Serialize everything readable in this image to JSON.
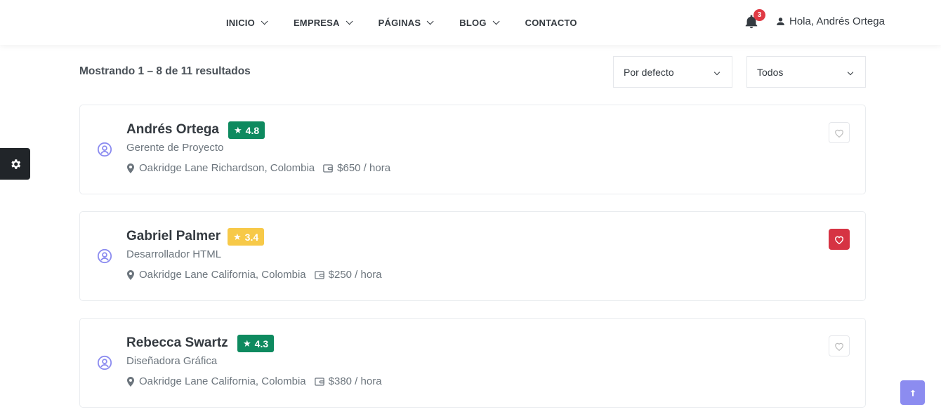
{
  "nav": {
    "items": [
      {
        "label": "INICIO",
        "has_dropdown": true
      },
      {
        "label": "EMPRESA",
        "has_dropdown": true
      },
      {
        "label": "PÁGINAS",
        "has_dropdown": true
      },
      {
        "label": "BLOG",
        "has_dropdown": true
      },
      {
        "label": "CONTACTO",
        "has_dropdown": false
      }
    ],
    "notifications": {
      "icon": "bell-icon",
      "count": "3"
    },
    "user": {
      "icon": "user-icon",
      "greeting": "Hola, Andrés Ortega"
    }
  },
  "results": {
    "summary": "Mostrando 1 – 8 de 11 resultados",
    "sort_select": {
      "value": "Por defecto"
    },
    "filter_select": {
      "value": "Todos"
    }
  },
  "settings": {
    "icon": "gear-icon"
  },
  "candidates": [
    {
      "name": "Andrés Ortega",
      "rating": "4.8",
      "rating_color": "#0e8a5f",
      "role": "Gerente de Proyecto",
      "location": "Oakridge Lane Richardson, Colombia",
      "rate": "$650 / hora",
      "favorited": false
    },
    {
      "name": "Gabriel Palmer",
      "rating": "3.4",
      "rating_color": "#f7c948",
      "role": "Desarrollador HTML",
      "location": "Oakridge Lane California, Colombia",
      "rate": "$250 / hora",
      "favorited": true
    },
    {
      "name": "Rebecca Swartz",
      "rating": "4.3",
      "rating_color": "#0e8a5f",
      "role": "Diseñadora Gráfica",
      "location": "Oakridge Lane California, Colombia",
      "rate": "$380 / hora",
      "favorited": false
    }
  ],
  "colors": {
    "accent": "#8c8cf0",
    "favorite_active": "#d63343",
    "badge": "#e03a44"
  },
  "back_to_top": {
    "icon": "arrow-up-icon"
  }
}
